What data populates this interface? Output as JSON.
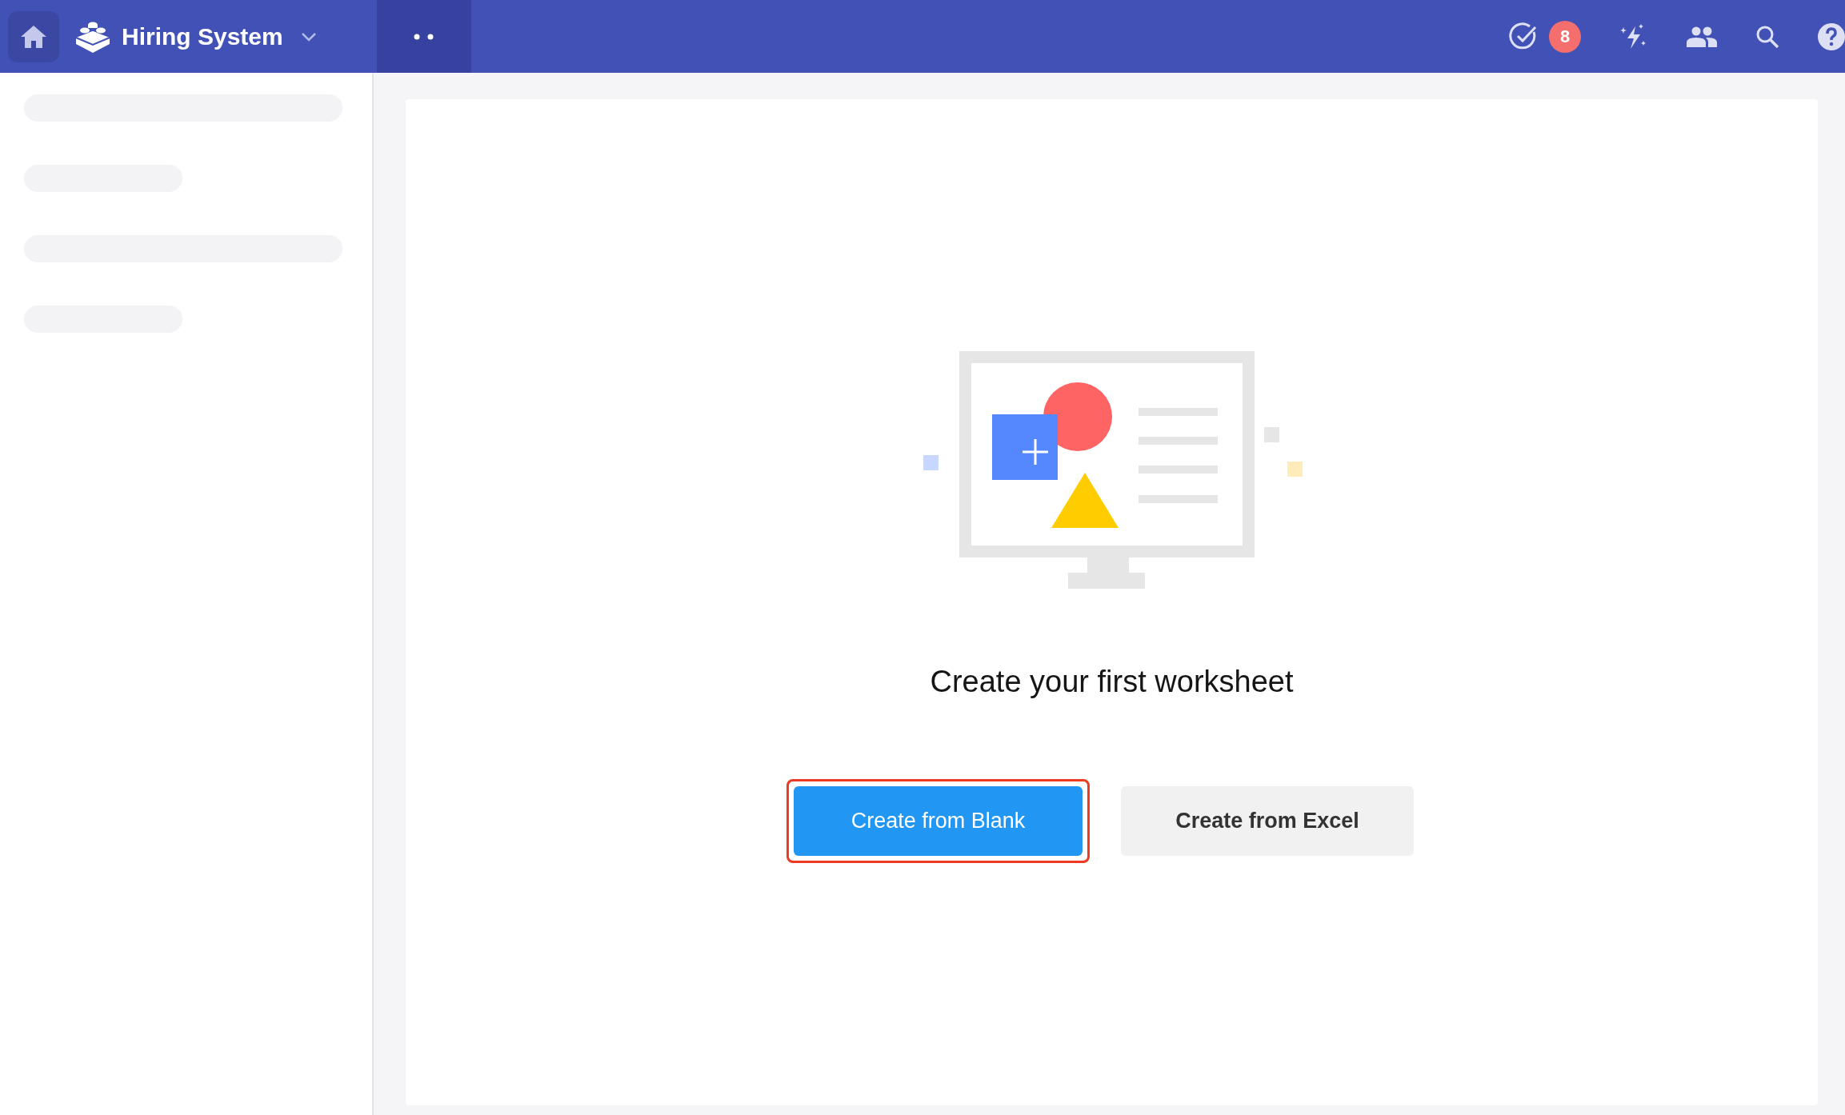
{
  "topbar": {
    "app_title": "Hiring System",
    "notification_count": "8"
  },
  "sidebar": {
    "loading": true
  },
  "empty_state": {
    "message": "Create your first worksheet",
    "buttons": [
      {
        "label": "Create from Blank",
        "kind": "primary",
        "highlighted": true
      },
      {
        "label": "Create from Excel",
        "kind": "secondary",
        "highlighted": false
      }
    ]
  }
}
